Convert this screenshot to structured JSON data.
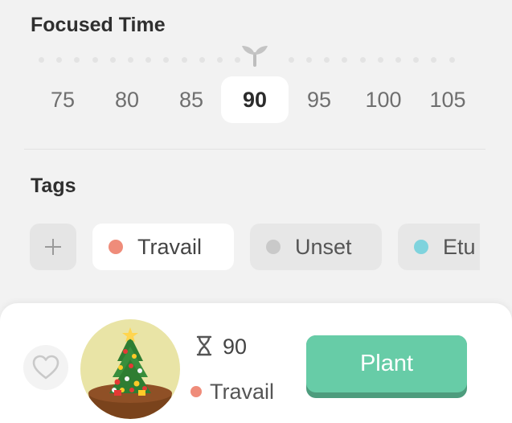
{
  "focused_time": {
    "title": "Focused Time",
    "options": [
      "75",
      "80",
      "85",
      "90",
      "95",
      "100",
      "105"
    ],
    "selected": "90"
  },
  "tags": {
    "title": "Tags",
    "add_icon": "plus-icon",
    "items": [
      {
        "label": "Travail",
        "color": "#ef8c7a",
        "selected": true
      },
      {
        "label": "Unset",
        "color": "#c9c9c9",
        "selected": false
      },
      {
        "label": "Etu",
        "color": "#7fd3dd",
        "selected": false
      }
    ]
  },
  "summary": {
    "favorite_icon": "heart-icon",
    "tree_icon": "christmas-tree-icon",
    "duration_icon": "hourglass-icon",
    "duration": "90",
    "tag_label": "Travail",
    "tag_color": "#ef8c7a",
    "plant_label": "Plant",
    "plant_color": "#67cca7"
  }
}
